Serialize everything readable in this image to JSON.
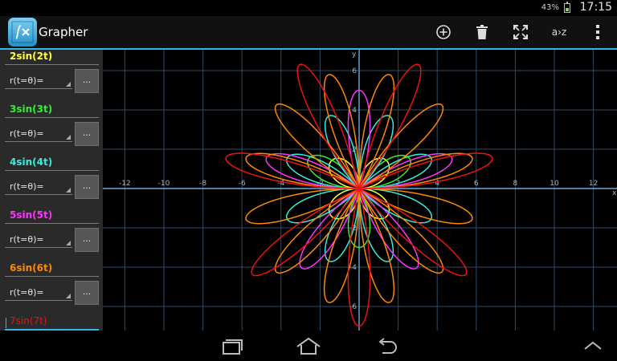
{
  "status": {
    "battery_percent": "43%",
    "battery_level": 0.43,
    "time": "17:15"
  },
  "app": {
    "title": "Grapher",
    "icon": "function-graph-icon"
  },
  "toolbar": {
    "items": [
      {
        "name": "add-icon"
      },
      {
        "name": "trash-icon"
      },
      {
        "name": "fit-screen-icon"
      },
      {
        "name": "sort-az",
        "label": "a›z"
      },
      {
        "name": "overflow-menu-icon"
      }
    ]
  },
  "sidebar": {
    "functions": [
      {
        "expr": "2sin(2t)",
        "color": "#ffff33"
      },
      {
        "expr": "3sin(3t)",
        "color": "#33ee33"
      },
      {
        "expr": "4sin(4t)",
        "color": "#33eedd"
      },
      {
        "expr": "5sin(5t)",
        "color": "#ff33ff"
      },
      {
        "expr": "6sin(6t)",
        "color": "#ff8800"
      },
      {
        "expr": "7sin(7t)",
        "color": "#ee1111"
      }
    ],
    "type_label": "r(t=θ)=",
    "button_label": "..."
  },
  "graph": {
    "x_axis_label": "x",
    "y_axis_label": "y",
    "x_ticks": [
      "-12",
      "-10",
      "-8",
      "-6",
      "-4",
      "-2",
      "2",
      "4",
      "6",
      "8",
      "10",
      "12"
    ],
    "y_ticks": [
      "6",
      "4",
      "2",
      "-2",
      "-4",
      "-6"
    ],
    "axis_color": "#6fa8d6",
    "grid_color": "#314a63"
  },
  "navbar": {
    "items": [
      "recent-apps-icon",
      "home-icon",
      "back-icon",
      "menu-up-icon"
    ]
  }
}
